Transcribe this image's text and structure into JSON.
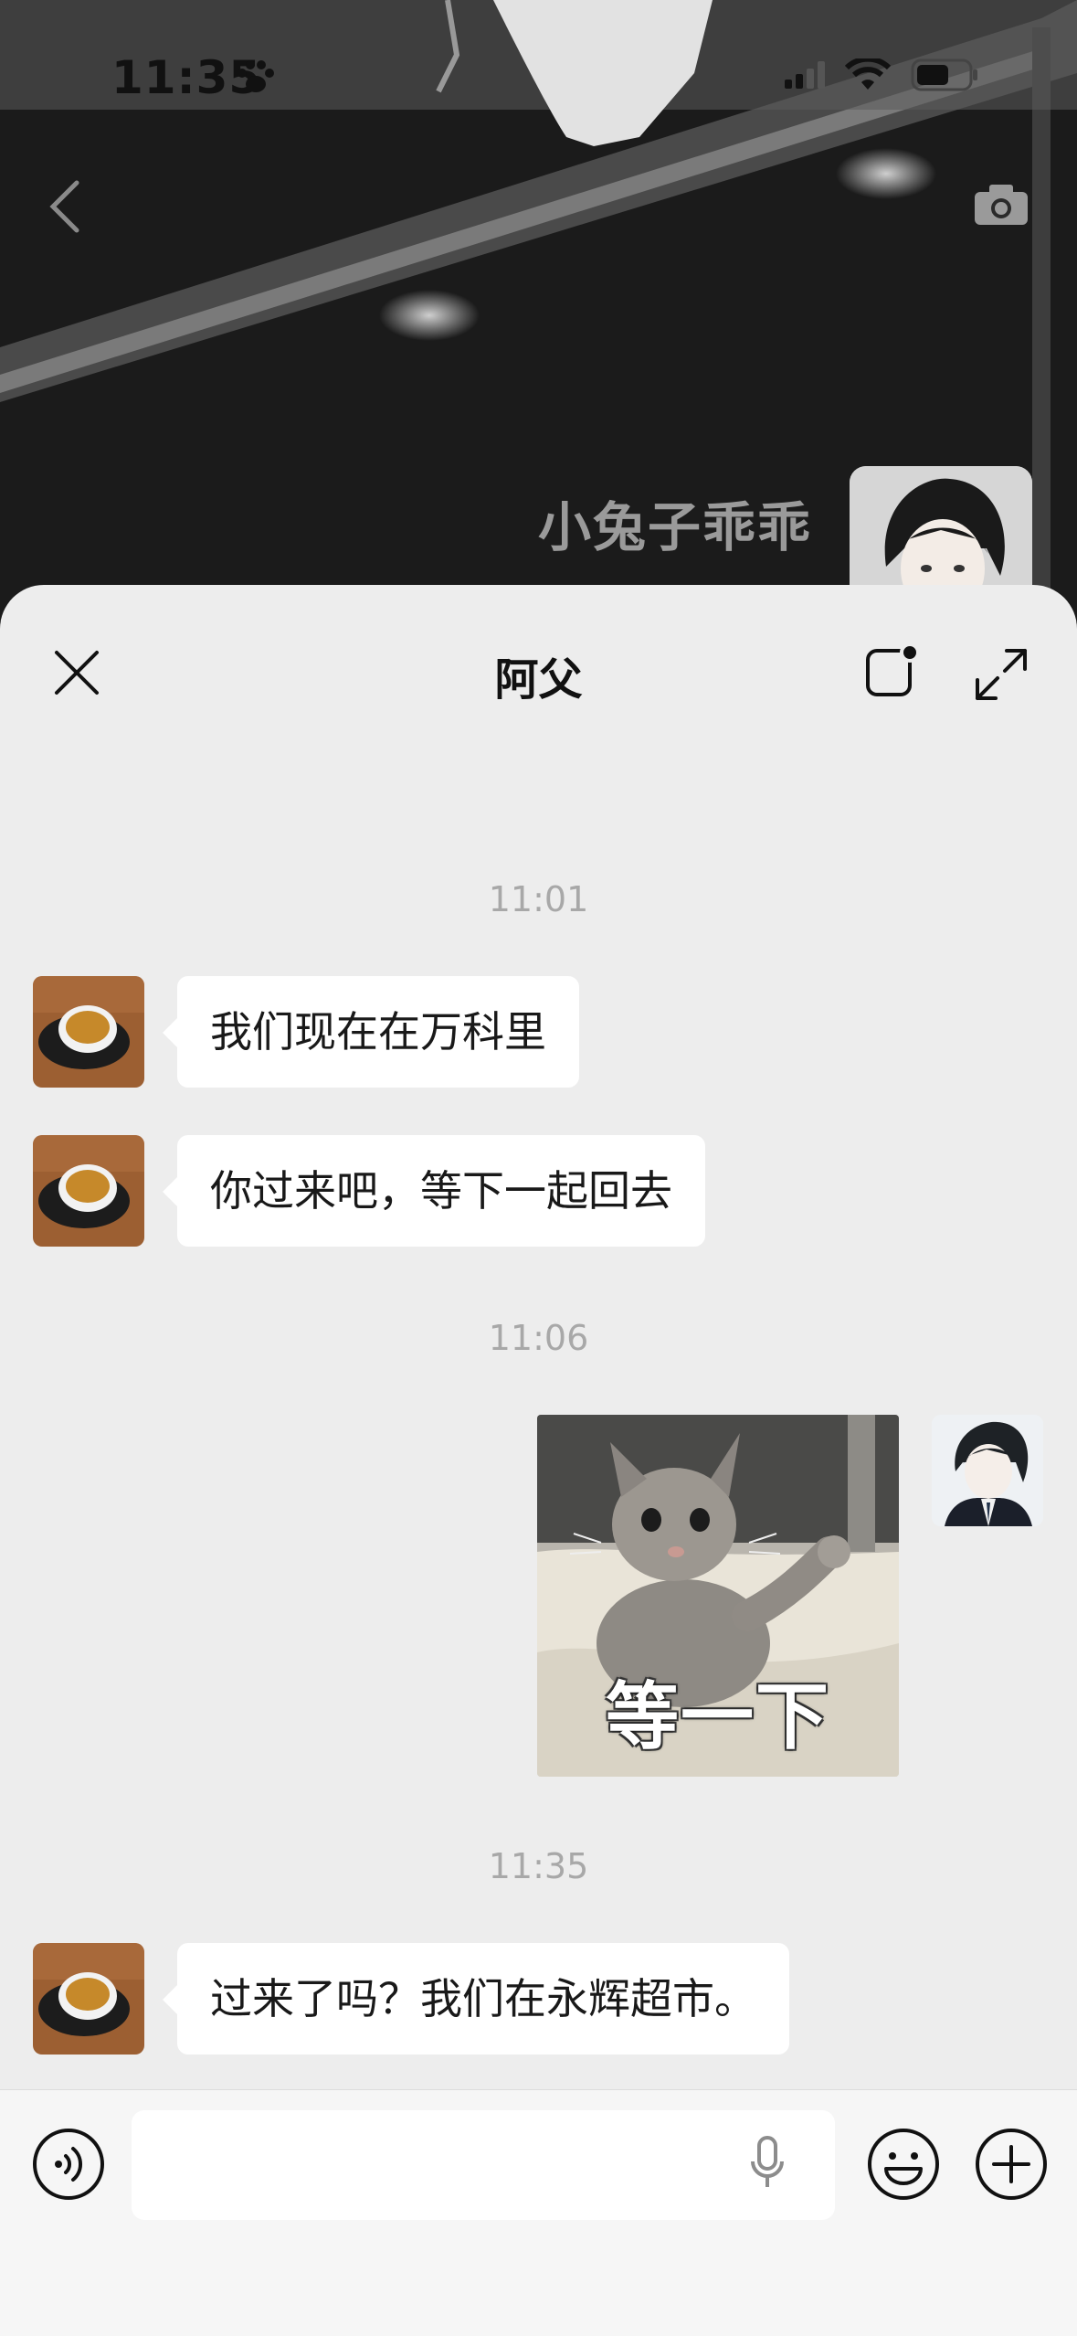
{
  "status_bar": {
    "time": "11:35"
  },
  "profile": {
    "name": "小兔子乖乖"
  },
  "chat": {
    "title": "阿父",
    "messages": [
      {
        "timestamp": "11:01"
      },
      {
        "sender": "other",
        "text": "我们现在在万科里"
      },
      {
        "sender": "other",
        "text": "你过来吧，等下一起回去"
      },
      {
        "timestamp": "11:06"
      },
      {
        "sender": "me",
        "sticker_caption": "等一下"
      },
      {
        "timestamp": "11:35"
      },
      {
        "sender": "other",
        "text": "过来了吗？我们在永辉超市。"
      }
    ]
  },
  "input": {
    "value": "",
    "placeholder": ""
  },
  "icons": {
    "back": "chevron-left-icon",
    "camera": "camera-icon",
    "close": "close-icon",
    "note": "note-icon",
    "expand": "expand-icon",
    "voice": "voice-icon",
    "mic": "mic-icon",
    "emoji": "emoji-icon",
    "plus": "plus-icon"
  }
}
